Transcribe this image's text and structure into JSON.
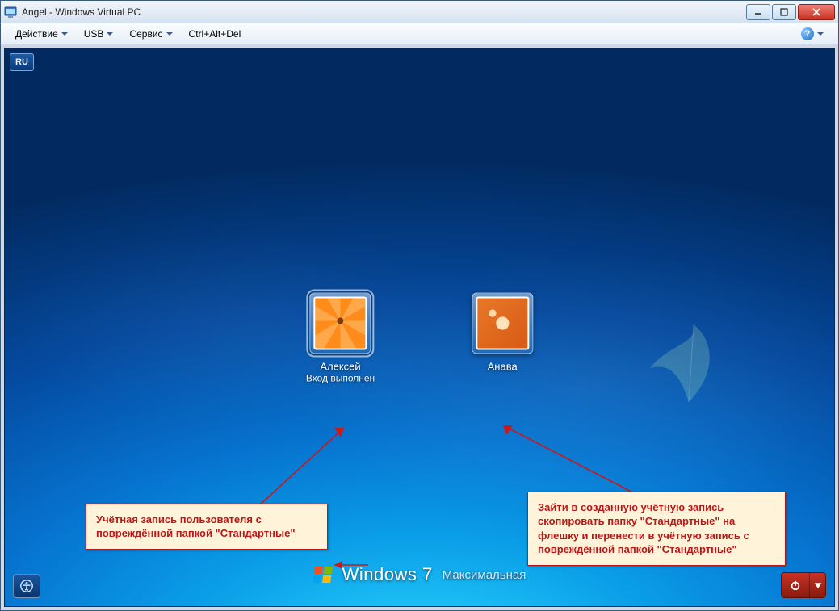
{
  "window": {
    "title": "Angel - Windows Virtual PC"
  },
  "menu": {
    "action": "Действие",
    "usb": "USB",
    "service": "Сервис",
    "cad": "Ctrl+Alt+Del"
  },
  "lang_indicator": "RU",
  "accounts": [
    {
      "name": "Алексей",
      "status": "Вход выполнен",
      "selected": true
    },
    {
      "name": "Анава",
      "status": "",
      "selected": false
    }
  ],
  "branding": {
    "product": "Windows",
    "version": "7",
    "edition": "Максимальная"
  },
  "callouts": {
    "left": "Учётная запись пользователя с повреждённой папкой \"Стандартные\"",
    "right": "Зайти в созданную учётную запись скопировать папку \"Стандартные\" на флешку  и перенести в учётную запись с повреждённой папкой \"Стандартные\""
  }
}
